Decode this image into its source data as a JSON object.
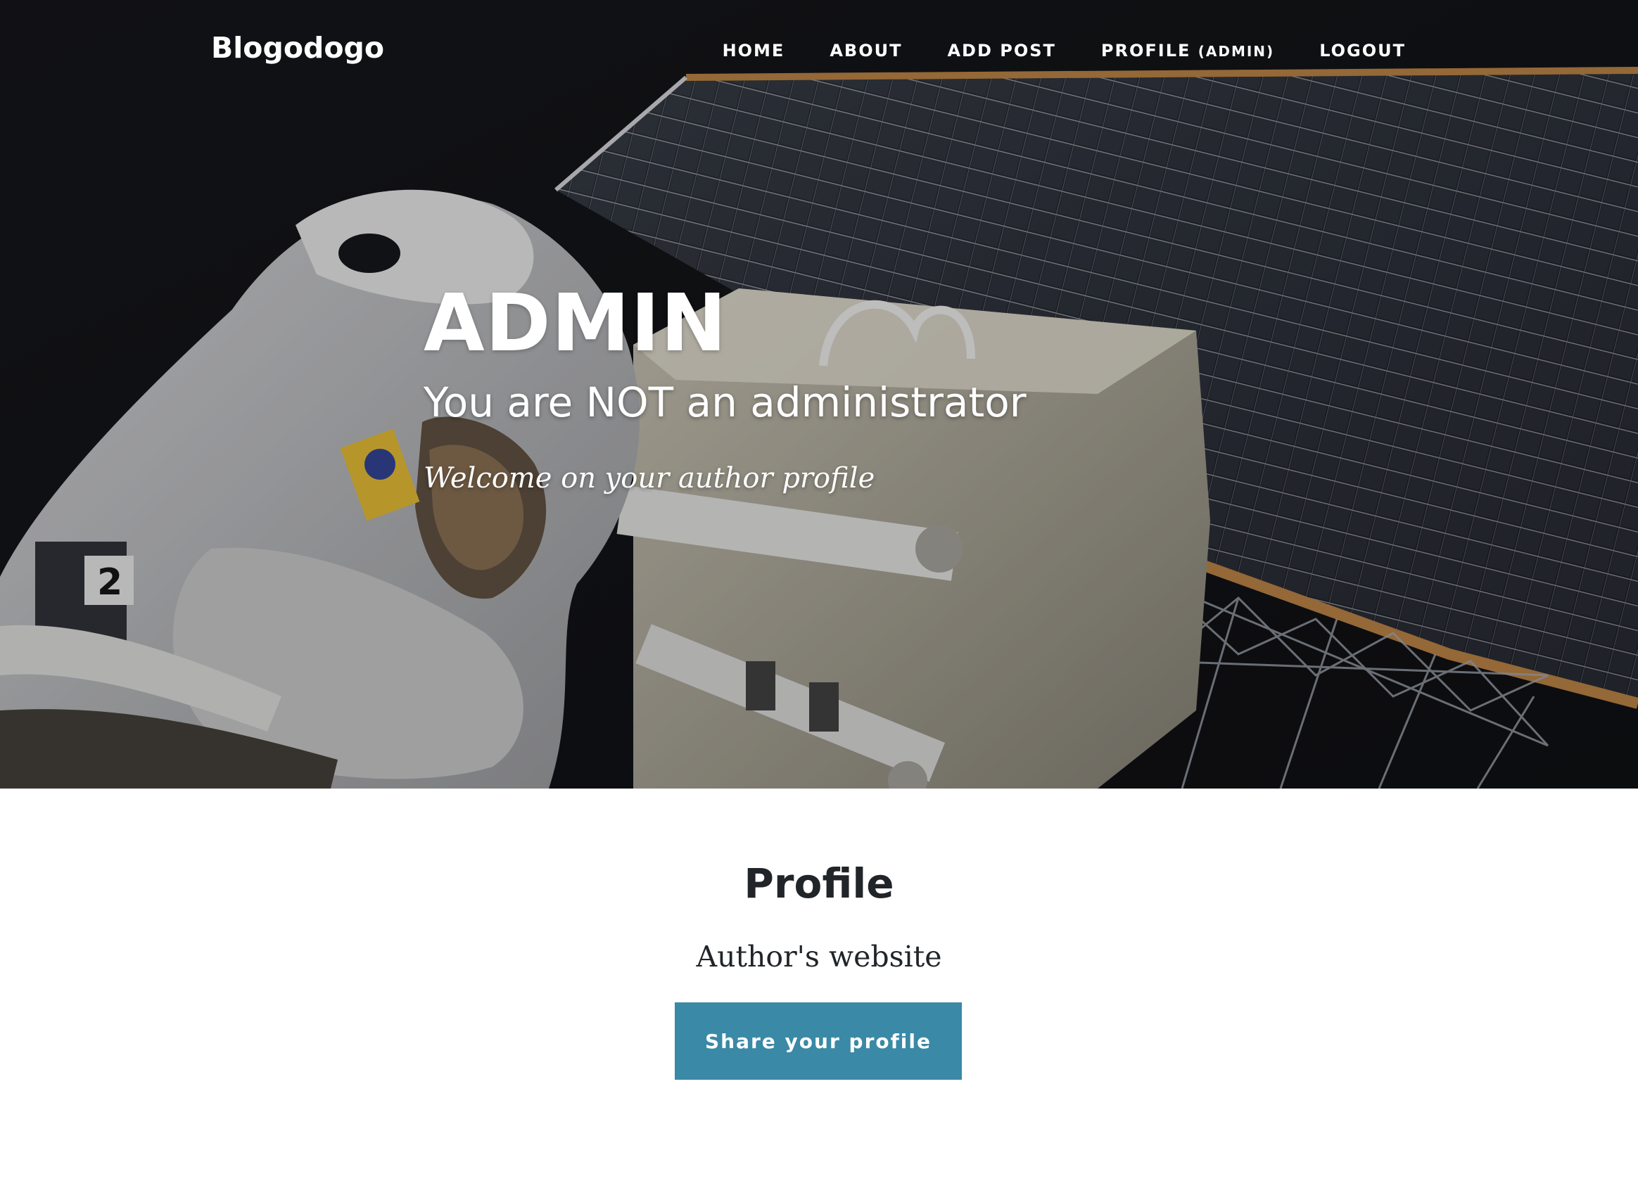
{
  "navbar": {
    "brand": "Blogodogo",
    "links": [
      {
        "label": "HOME"
      },
      {
        "label": "ABOUT"
      },
      {
        "label": "ADD POST"
      },
      {
        "label": "PROFILE",
        "suffix": "(ADMIN)"
      },
      {
        "label": "LOGOUT"
      }
    ]
  },
  "hero": {
    "title": "ADMIN",
    "subtitle": "You are NOT an administrator",
    "meta": "Welcome on your author profile",
    "background_image": "astronaut-spacewalk-solar-panel-photo"
  },
  "content": {
    "heading": "Profile",
    "author_link": "Author's website",
    "share_button": "Share your profile"
  },
  "colors": {
    "hero_background": "#0c0d10",
    "button": "#3a89a6",
    "text_dark": "#212529",
    "nav_text": "#ffffff"
  }
}
